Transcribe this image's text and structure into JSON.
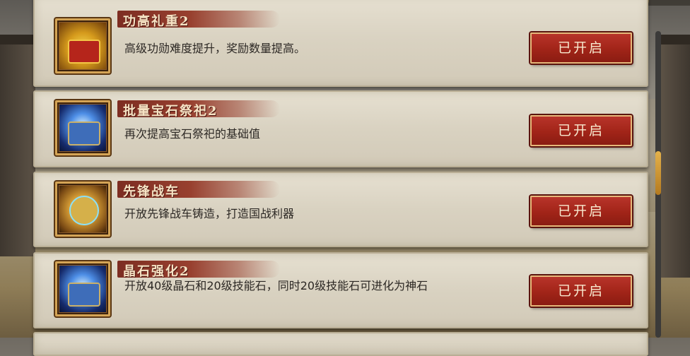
{
  "colors": {
    "card_bg": "#dcd5c4",
    "ribbon": "#8f3a2c",
    "button": "#a8281c",
    "button_text": "#f8e9cf",
    "scroll_thumb": "#e5b24b"
  },
  "items": [
    {
      "title": "功高礼重2",
      "description": "高级功勋难度提升，奖励数量提高。",
      "status": "已开启",
      "icon": "treasure-chest-gold-icon"
    },
    {
      "title": "批量宝石祭祀2",
      "description": "再次提高宝石祭祀的基础值",
      "status": "已开启",
      "icon": "gem-chest-icon"
    },
    {
      "title": "先锋战车",
      "description": "开放先锋战车铸造，打造国战利器",
      "status": "已开启",
      "icon": "chariot-emblem-icon"
    },
    {
      "title": "晶石强化2",
      "description": "开放40级晶石和20级技能石，同时20级技能石可进化为神石",
      "status": "已开启",
      "icon": "gem-chest-icon"
    }
  ]
}
